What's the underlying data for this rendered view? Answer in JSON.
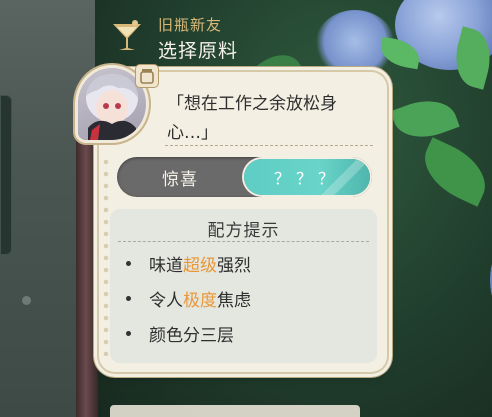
{
  "header": {
    "subtitle": "旧瓶新友",
    "title": "选择原料",
    "icon": "cocktail-glass-icon"
  },
  "card": {
    "avatar_icon": "character-portrait",
    "badge_icon": "jar-icon",
    "quote": "「想在工作之余放松身心…」",
    "toggle": {
      "left_label": "惊喜",
      "right_label": "？？？",
      "selected": "right"
    },
    "hints": {
      "title": "配方提示",
      "items": [
        {
          "pre": "味道",
          "highlight": "超级",
          "post": "强烈"
        },
        {
          "pre": "令人",
          "highlight": "极度",
          "post": "焦虑"
        },
        {
          "pre": "颜色分三层",
          "highlight": "",
          "post": ""
        }
      ]
    }
  },
  "colors": {
    "accent_teal": "#5ecdc4",
    "highlight_orange": "#e99838",
    "header_gold": "#d9b978",
    "card_bg": "#f3efe3"
  }
}
